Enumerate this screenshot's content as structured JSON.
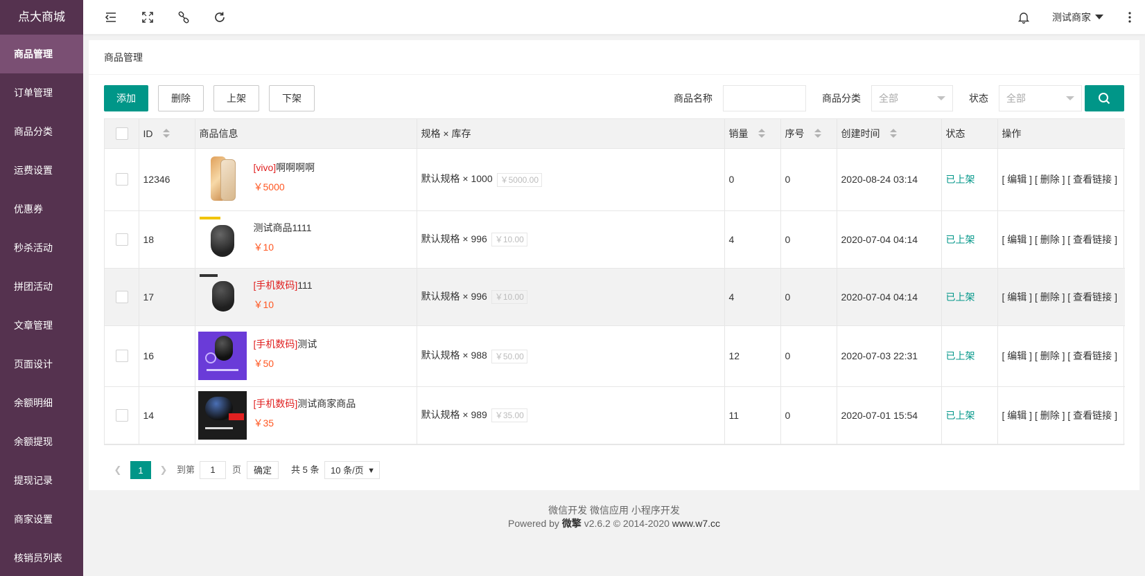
{
  "sidebar": {
    "brand": "点大商城",
    "items": [
      {
        "label": "商品管理",
        "active": true
      },
      {
        "label": "订单管理"
      },
      {
        "label": "商品分类"
      },
      {
        "label": "运费设置"
      },
      {
        "label": "优惠券"
      },
      {
        "label": "秒杀活动"
      },
      {
        "label": "拼团活动"
      },
      {
        "label": "文章管理"
      },
      {
        "label": "页面设计"
      },
      {
        "label": "余额明细"
      },
      {
        "label": "余额提现"
      },
      {
        "label": "提现记录"
      },
      {
        "label": "商家设置"
      },
      {
        "label": "核销员列表"
      }
    ]
  },
  "header": {
    "user": "测试商家",
    "icons": [
      "menu-collapse-icon",
      "fullscreen-icon",
      "link-icon",
      "refresh-icon",
      "bell-icon",
      "more-vertical-icon"
    ]
  },
  "page": {
    "title": "商品管理"
  },
  "toolbar": {
    "add": "添加",
    "delete": "删除",
    "on_shelf": "上架",
    "off_shelf": "下架"
  },
  "filters": {
    "name_label": "商品名称",
    "name_value": "",
    "category_label": "商品分类",
    "category_value": "全部",
    "status_label": "状态",
    "status_value": "全部"
  },
  "table": {
    "columns": [
      "ID",
      "商品信息",
      "规格 × 库存",
      "销量",
      "序号",
      "创建时间",
      "状态",
      "操作"
    ],
    "rows": [
      {
        "id": "12346",
        "cat": "[vivo]",
        "name": "啊啊啊啊",
        "price": "￥5000",
        "spec": "默认规格 × 1000",
        "spec_price": "￥5000.00",
        "sales": "0",
        "order": "0",
        "created": "2020-08-24 03:14",
        "status": "已上架"
      },
      {
        "id": "18",
        "cat": "",
        "name": "测试商品1111",
        "price": "￥10",
        "spec": "默认规格 × 996",
        "spec_price": "￥10.00",
        "sales": "4",
        "order": "0",
        "created": "2020-07-04 04:14",
        "status": "已上架"
      },
      {
        "id": "17",
        "cat": "[手机数码]",
        "name": "111",
        "price": "￥10",
        "spec": "默认规格 × 996",
        "spec_price": "￥10.00",
        "sales": "4",
        "order": "0",
        "created": "2020-07-04 04:14",
        "status": "已上架"
      },
      {
        "id": "16",
        "cat": "[手机数码]",
        "name": "测试",
        "price": "￥50",
        "spec": "默认规格 × 988",
        "spec_price": "￥50.00",
        "sales": "12",
        "order": "0",
        "created": "2020-07-03 22:31",
        "status": "已上架"
      },
      {
        "id": "14",
        "cat": "[手机数码]",
        "name": "测试商家商品",
        "price": "￥35",
        "spec": "默认规格 × 989",
        "spec_price": "￥35.00",
        "sales": "11",
        "order": "0",
        "created": "2020-07-01 15:54",
        "status": "已上架"
      }
    ],
    "ops": {
      "edit": "[ 编辑 ]",
      "delete": "[ 删除 ]",
      "view_link": "[ 查看链接 ]"
    }
  },
  "pagination": {
    "current": "1",
    "goto_label": "到第",
    "goto_value": "1",
    "page_unit": "页",
    "confirm": "确定",
    "total": "共 5 条",
    "per_page": "10 条/页"
  },
  "footer": {
    "links": "微信开发 微信应用 小程序开发",
    "powered_prefix": "Powered by ",
    "brand": "微擎",
    "powered_suffix": " v2.6.2 © 2014-2020 ",
    "site": "www.w7.cc"
  },
  "colors": {
    "sidebar_bg": "#55324f",
    "sidebar_active": "#7a4f73",
    "primary": "#009688",
    "price": "#ff5722",
    "category": "#e02020"
  }
}
